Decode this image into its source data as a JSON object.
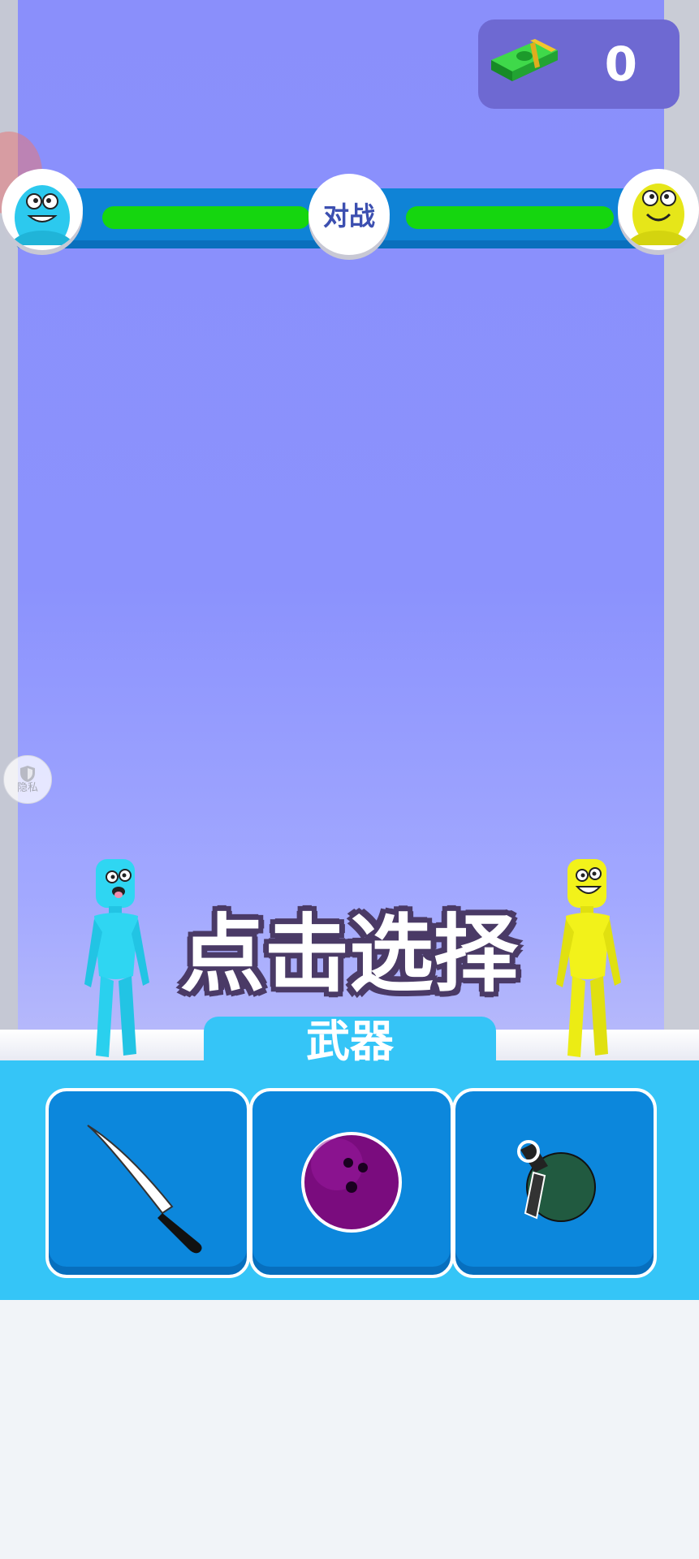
{
  "hud": {
    "money": {
      "icon": "cash-stack-icon",
      "value": "0"
    },
    "battle_label": "对战",
    "player_health": 1.0,
    "enemy_health": 1.0
  },
  "privacy": {
    "icon": "shield-icon",
    "label": "隐私"
  },
  "prompt": {
    "text": "点击选择"
  },
  "weapons": {
    "tab_label": "武器",
    "items": [
      {
        "icon": "knife-icon"
      },
      {
        "icon": "bowling-ball-icon"
      },
      {
        "icon": "grenade-icon"
      }
    ]
  },
  "colors": {
    "sky": "#8a8ffb",
    "panel": "#35c5f7",
    "card": "#0c87dc",
    "health": "#15d60f",
    "bar": "#0f83d6"
  }
}
